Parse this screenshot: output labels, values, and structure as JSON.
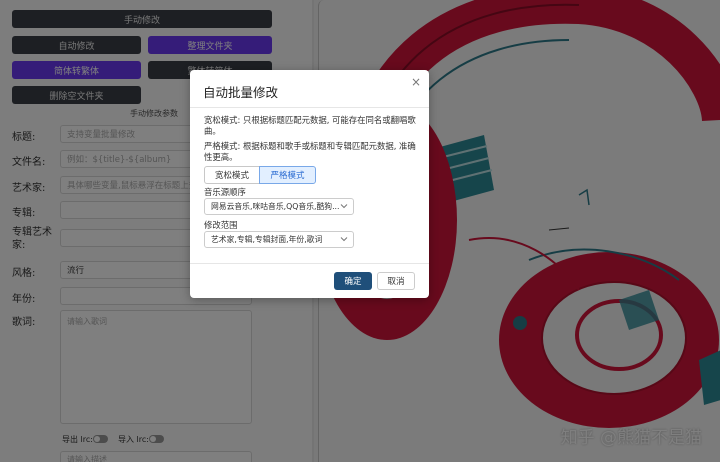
{
  "left_panel": {
    "buttons": {
      "manual_edit": "手动修改",
      "auto_edit": "自动修改",
      "organize_folder": "整理文件夹",
      "simp_to_trad": "简体转繁体",
      "trad_to_simp": "繁体转简体",
      "delete_empty_folder": "删除空文件夹"
    },
    "params_title": "手动修改参数",
    "fields": {
      "title_label": "标题:",
      "title_placeholder": "支持变量批量修改",
      "filename_label": "文件名:",
      "filename_placeholder": "例如：${title}-${album}",
      "artist_label": "艺术家:",
      "artist_placeholder": "具体哪些变量,鼠标悬浮在标题上查看",
      "album_label": "专辑:",
      "album_artist_label": "专辑艺术家:",
      "genre_label": "风格:",
      "genre_value": "流行",
      "year_label": "年份:",
      "lyrics_label": "歌词:",
      "lyrics_placeholder": "请输入歌词",
      "export_lrc": "导出 lrc:",
      "import_lrc": "导入 lrc:",
      "notes_placeholder": "请输入描述"
    }
  },
  "watermark": "知乎 @熊猫不是猫",
  "modal": {
    "title": "自动批量修改",
    "close": "×",
    "loose_desc": "宽松模式: 只根据标题匹配元数据, 可能存在同名或翻唱歌曲。",
    "strict_desc": "严格模式: 根据标题和歌手或标题和专辑匹配元数据, 准确性更高。",
    "mode_loose": "宽松模式",
    "mode_strict": "严格模式",
    "source_label": "音乐源顺序",
    "source_value": "网易云音乐,咪咕音乐,QQ音乐,酷狗...",
    "scope_label": "修改范围",
    "scope_value": "艺术家,专辑,专辑封面,年份,歌词",
    "ok": "确定",
    "cancel": "取消"
  },
  "colors": {
    "accent_purple": "#6b38f2",
    "dark_button": "#3b3f47",
    "ok_button": "#1f4f7a",
    "active_mode_bg": "#e2efff",
    "headphone_red": "#d0153a"
  }
}
